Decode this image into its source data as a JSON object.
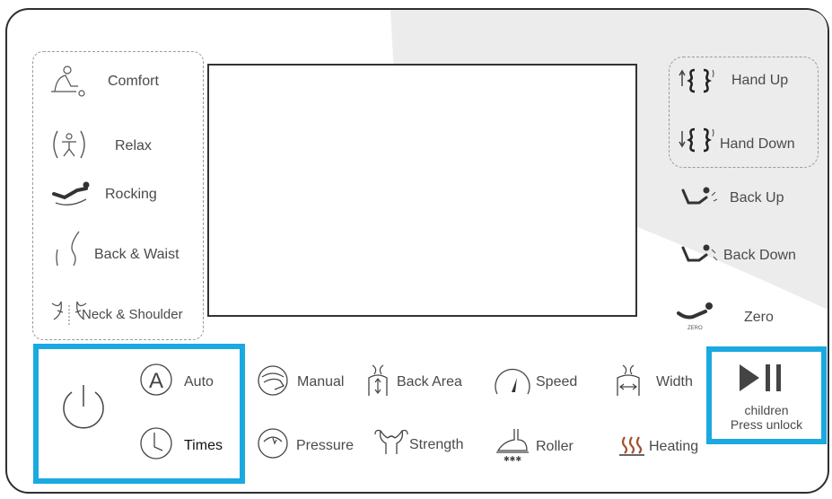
{
  "left_programs": {
    "comfort": "Comfort",
    "relax": "Relax",
    "rocking": "Rocking",
    "back_waist": "Back & Waist",
    "neck_shoulder": "Neck & Shoulder"
  },
  "right_controls": {
    "hand_up": "Hand Up",
    "hand_down": "Hand Down",
    "back_up": "Back Up",
    "back_down": "Back Down",
    "zero": "Zero",
    "zero_icon_text": "ZERO"
  },
  "bottom_row1": {
    "auto": "Auto",
    "manual": "Manual",
    "back_area": "Back Area",
    "speed": "Speed",
    "width": "Width"
  },
  "bottom_row2": {
    "times": "Times",
    "pressure": "Pressure",
    "strength": "Strength",
    "roller": "Roller",
    "heating": "Heating"
  },
  "play_pause": {
    "line1": "children",
    "line2": "Press unlock"
  },
  "colors": {
    "highlight": "#1aa9e1",
    "border": "#2e2e2e",
    "heating": "#a0522d"
  },
  "icons": [
    "comfort-icon",
    "relax-icon",
    "rocking-icon",
    "back-waist-icon",
    "neck-shoulder-icon",
    "hand-up-icon",
    "hand-down-icon",
    "back-up-icon",
    "back-down-icon",
    "zero-icon",
    "power-icon",
    "auto-icon",
    "clock-icon",
    "manual-icon",
    "back-area-icon",
    "speed-icon",
    "width-icon",
    "pressure-icon",
    "strength-icon",
    "roller-icon",
    "heating-icon",
    "play-pause-icon"
  ]
}
